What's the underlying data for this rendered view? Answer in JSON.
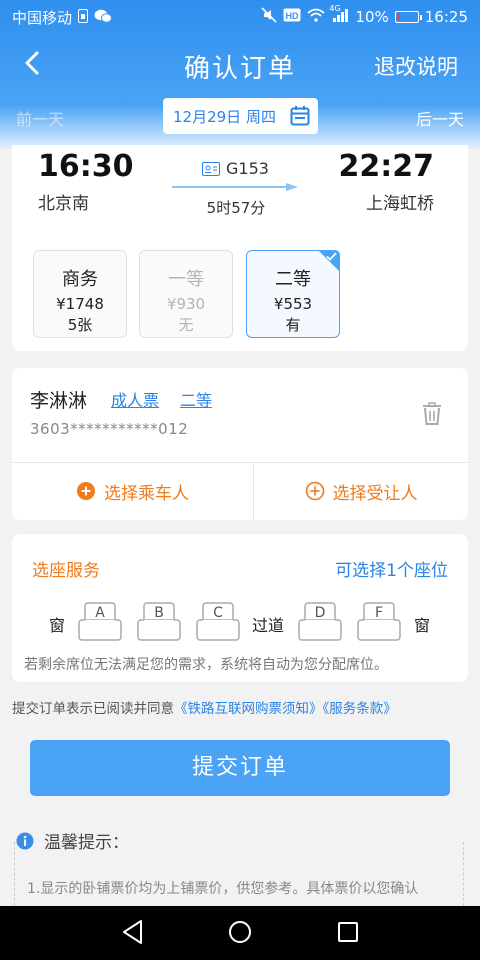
{
  "status_bar": {
    "carrier": "中国移动",
    "battery": "10%",
    "time": "16:25",
    "network": "4G",
    "battery_color": "#ff3b30"
  },
  "nav": {
    "title": "确认订单",
    "right_link": "退改说明"
  },
  "date_bar": {
    "prev": "前一天",
    "next": "后一天",
    "date": "12月29日 周四"
  },
  "train": {
    "dep_time": "16:30",
    "dep_station": "北京南",
    "arr_time": "22:27",
    "arr_station": "上海虹桥",
    "number": "G153",
    "duration": "5时57分"
  },
  "seat_classes": [
    {
      "name": "商务",
      "price": "¥1748",
      "count": "5张",
      "state": "available"
    },
    {
      "name": "一等",
      "price": "¥930",
      "count": "无",
      "state": "disabled"
    },
    {
      "name": "二等",
      "price": "¥553",
      "count": "有",
      "state": "selected"
    }
  ],
  "passenger": {
    "name": "李淋淋",
    "ticket_type": "成人票",
    "seat_class": "二等",
    "id_masked": "3603***********012",
    "add_passenger": "选择乘车人",
    "add_beneficiary": "选择受让人"
  },
  "seat_service": {
    "title": "选座服务",
    "hint": "可选择1个座位",
    "window": "窗",
    "aisle": "过道",
    "seats_left": [
      "A",
      "B",
      "C"
    ],
    "seats_right": [
      "D",
      "F"
    ],
    "note": "若剩余席位无法满足您的需求，系统将自动为您分配席位。"
  },
  "agreement": {
    "prefix": "提交订单表示已阅读并同意",
    "link1": "《铁路互联网购票须知》",
    "link2": "《服务条款》"
  },
  "submit_label": "提交订单",
  "tips": {
    "title": "温馨提示：",
    "line1": "1.显示的卧铺票价均为上铺票价，供您参考。具体票价以您确认"
  },
  "colors": {
    "brand_blue": "#4aa3f5",
    "link_blue": "#2a83e8",
    "accent_orange": "#ef7b1a"
  }
}
